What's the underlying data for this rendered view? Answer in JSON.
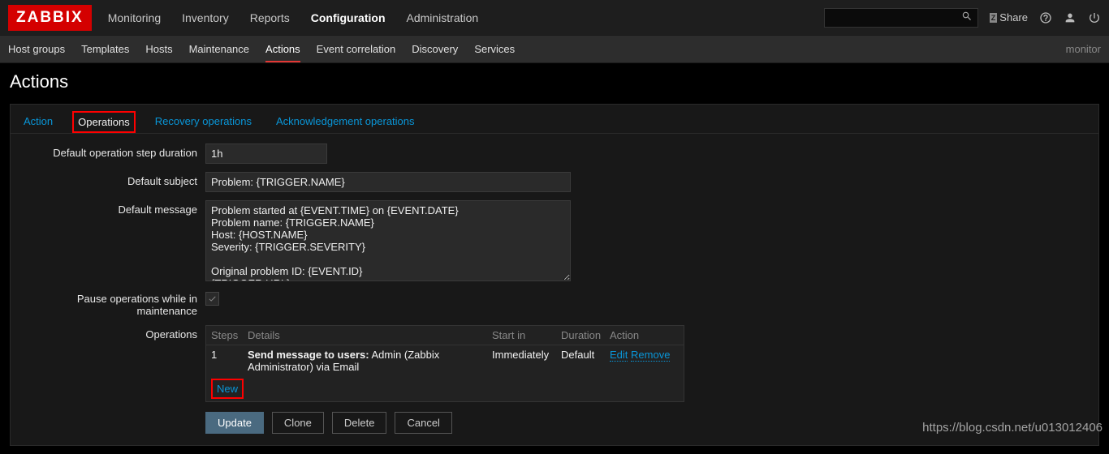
{
  "header": {
    "logo": "ZABBIX",
    "nav": [
      "Monitoring",
      "Inventory",
      "Reports",
      "Configuration",
      "Administration"
    ],
    "nav_active": 3,
    "share_label": "Share"
  },
  "subnav": {
    "items": [
      "Host groups",
      "Templates",
      "Hosts",
      "Maintenance",
      "Actions",
      "Event correlation",
      "Discovery",
      "Services"
    ],
    "active": 4,
    "right_text": "monitor"
  },
  "page_title": "Actions",
  "tabs": [
    "Action",
    "Operations",
    "Recovery operations",
    "Acknowledgement operations"
  ],
  "tabs_active": 1,
  "form": {
    "labels": {
      "duration": "Default operation step duration",
      "subject": "Default subject",
      "message": "Default message",
      "pause": "Pause operations while in maintenance",
      "operations": "Operations"
    },
    "values": {
      "duration": "1h",
      "subject": "Problem: {TRIGGER.NAME}",
      "message": "Problem started at {EVENT.TIME} on {EVENT.DATE}\nProblem name: {TRIGGER.NAME}\nHost: {HOST.NAME}\nSeverity: {TRIGGER.SEVERITY}\n\nOriginal problem ID: {EVENT.ID}\n{TRIGGER.URL}"
    }
  },
  "ops_table": {
    "headers": {
      "steps": "Steps",
      "details": "Details",
      "startin": "Start in",
      "duration": "Duration",
      "action": "Action"
    },
    "row": {
      "steps": "1",
      "details_bold": "Send message to users:",
      "details_rest": " Admin (Zabbix Administrator) via Email",
      "startin": "Immediately",
      "duration": "Default",
      "edit": "Edit",
      "remove": "Remove"
    },
    "new_label": "New"
  },
  "buttons": {
    "update": "Update",
    "clone": "Clone",
    "delete": "Delete",
    "cancel": "Cancel"
  },
  "watermark": "https://blog.csdn.net/u013012406"
}
